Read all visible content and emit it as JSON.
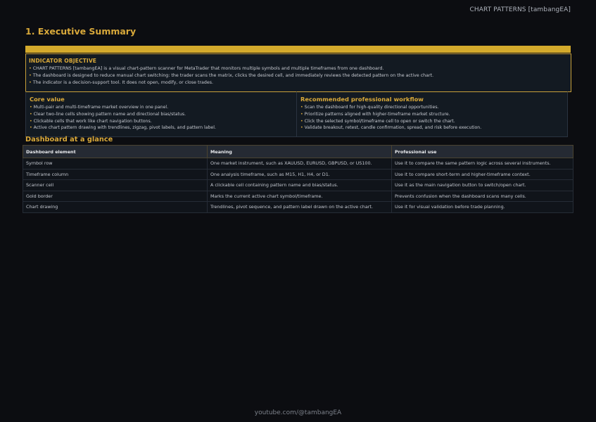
{
  "header": {
    "right_title": "CHART PATTERNS [tambangEA]"
  },
  "section": {
    "title": "1. Executive Summary"
  },
  "objective": {
    "title": "INDICATOR OBJECTIVE",
    "bullets": [
      "CHART PATTERNS [tambangEA] is a visual chart-pattern scanner for MetaTrader that monitors multiple symbols and multiple timeframes from one dashboard.",
      "The dashboard is designed to reduce manual chart switching: the trader scans the matrix, clicks the desired cell, and immediately reviews the detected pattern on the active chart.",
      "The indicator is a decision-support tool. It does not open, modify, or close trades."
    ]
  },
  "core_value": {
    "title": "Core value",
    "bullets": [
      "Multi-pair and multi-timeframe market overview in one panel.",
      "Clear two-line cells showing pattern name and directional bias/status.",
      "Clickable cells that work like chart navigation buttons.",
      "Active chart pattern drawing with trendlines, zigzag, pivot labels, and pattern label."
    ]
  },
  "workflow": {
    "title": "Recommended professional workflow",
    "bullets": [
      "Scan the dashboard for high-quality directional opportunities.",
      "Prioritize patterns aligned with higher-timeframe market structure.",
      "Click the selected symbol/timeframe cell to open or switch the chart.",
      "Validate breakout, retest, candle confirmation, spread, and risk before execution."
    ]
  },
  "glance": {
    "title": "Dashboard at a glance",
    "headers": [
      "Dashboard element",
      "Meaning",
      "Professional use"
    ],
    "rows": [
      [
        "Symbol row",
        "One market instrument, such as XAUUSD, EURUSD, GBPUSD, or US100.",
        "Use it to compare the same pattern logic across several instruments."
      ],
      [
        "Timeframe column",
        "One analysis timeframe, such as M15, H1, H4, or D1.",
        "Use it to compare short-term and higher-timeframe context."
      ],
      [
        "Scanner cell",
        "A clickable cell containing pattern name and bias/status.",
        "Use it as the main navigation button to switch/open chart."
      ],
      [
        "Gold border",
        "Marks the current active chart symbol/timeframe.",
        "Prevents confusion when the dashboard scans many cells."
      ],
      [
        "Chart drawing",
        "Trendlines, pivot sequence, and pattern label drawn on the active chart.",
        "Use it for visual validation before trade planning."
      ]
    ]
  },
  "footer": {
    "text": "youtube.com/@tambangEA"
  },
  "colors": {
    "accent": "#d9a93a",
    "bar": "#d4aa2c",
    "background": "#0c0d11"
  }
}
